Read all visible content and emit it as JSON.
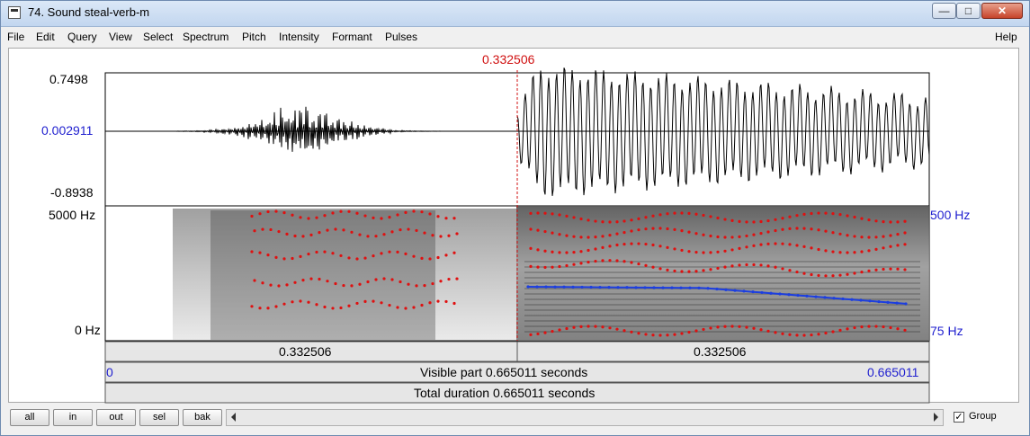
{
  "window": {
    "title": "74. Sound steal-verb-m",
    "controls": {
      "minimize": "—",
      "maximize": "□",
      "close": "✕"
    }
  },
  "menu": [
    "File",
    "Edit",
    "Query",
    "View",
    "Select",
    "Spectrum",
    "Pitch",
    "Intensity",
    "Formant",
    "Pulses"
  ],
  "menu_help": "Help",
  "cursor": {
    "time_label": "0.332506"
  },
  "waveform": {
    "top": "0.7498",
    "center": "0.002911",
    "bottom": "-0.8938"
  },
  "spectrogram": {
    "top": "5000 Hz",
    "bottom": "0 Hz",
    "pitch_top": "500 Hz",
    "pitch_bottom": "75 Hz"
  },
  "timebars": {
    "left_segment": "0.332506",
    "right_segment": "0.332506",
    "visible_start": "0",
    "visible_text": "Visible part 0.665011 seconds",
    "visible_end": "0.665011",
    "total_text": "Total duration 0.665011 seconds"
  },
  "buttons": {
    "all": "all",
    "in": "in",
    "out": "out",
    "sel": "sel",
    "bak": "bak"
  },
  "group": {
    "label": "Group",
    "checked": "✓"
  },
  "colors": {
    "cursor": "#d01010",
    "blue_axis": "#1f1fcf",
    "formant": "#e01010",
    "pitch": "#1c3ee0"
  }
}
